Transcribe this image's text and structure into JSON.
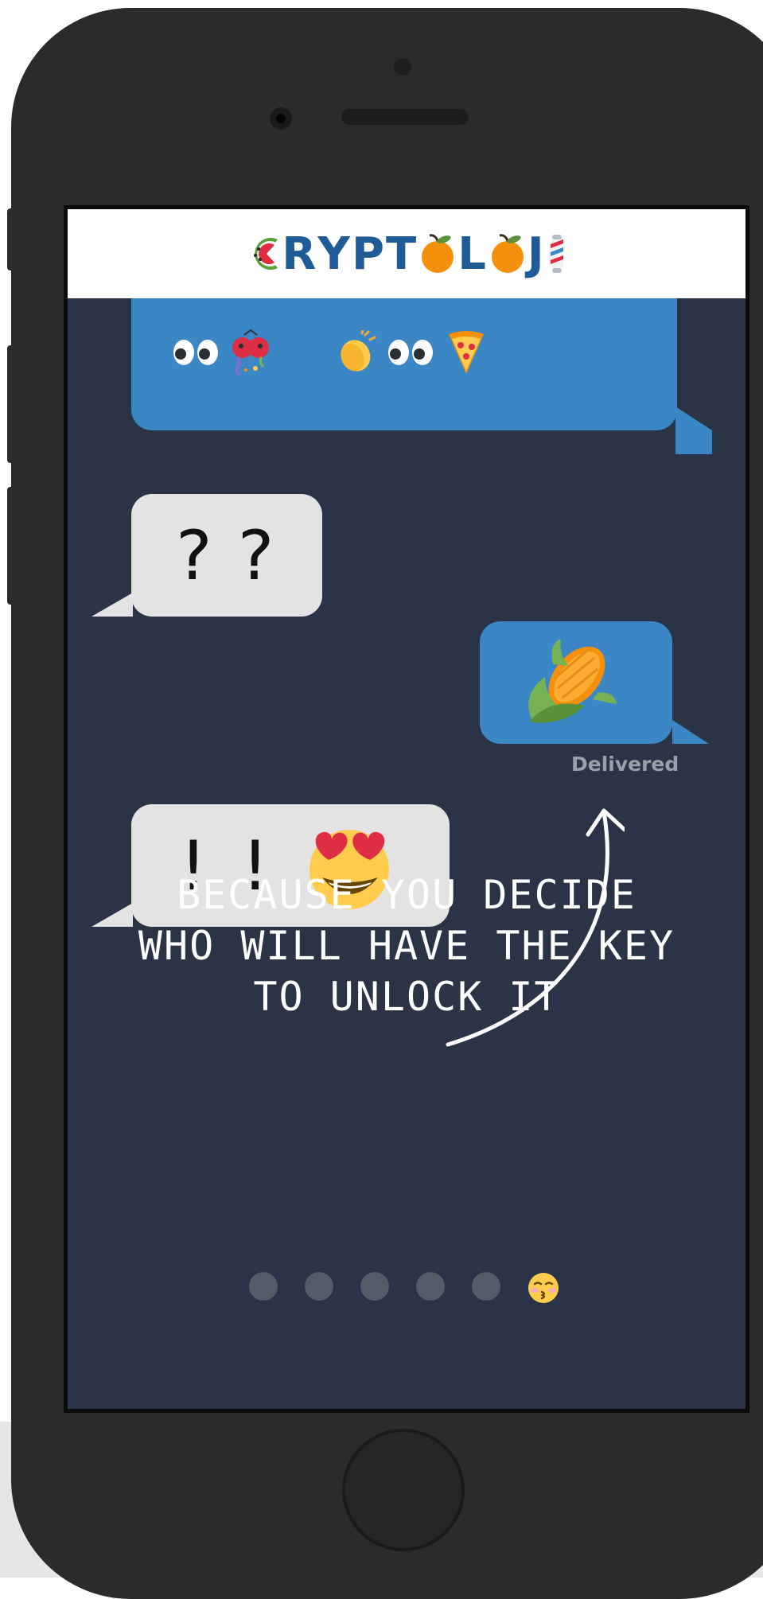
{
  "app": {
    "logo": {
      "letters": [
        "R",
        "Y",
        "P",
        "T",
        "L",
        "J"
      ],
      "glyph_icons": [
        "watermelon-icon",
        "orange-icon",
        "orange-icon",
        "barber-pole-icon"
      ]
    }
  },
  "messages": [
    {
      "side": "sent",
      "content_icons": [
        "eyes-icon",
        "beetle-confetti-icon",
        "clapping-hands-icon",
        "eyes-icon",
        "pizza-icon"
      ]
    },
    {
      "side": "received",
      "text": "??"
    },
    {
      "side": "sent",
      "content_icons": [
        "corn-icon"
      ],
      "status": "Delivered"
    },
    {
      "side": "received",
      "text": "!!",
      "content_icons": [
        "heart-eyes-icon"
      ]
    }
  ],
  "tagline": {
    "line1": "BECAUSE YOU DECIDE",
    "line2": "WHO WILL HAVE THE KEY",
    "line3": "TO UNLOCK IT"
  },
  "pagination": {
    "total": 6,
    "current": 6,
    "active_icon": "kissing-face-icon"
  },
  "colors": {
    "screen_bg": "#2a3446",
    "sent_bubble": "#3b86c5",
    "received_bubble": "#e3e3e3",
    "logo": "#1f5b96",
    "dot_inactive": "#535b67"
  }
}
